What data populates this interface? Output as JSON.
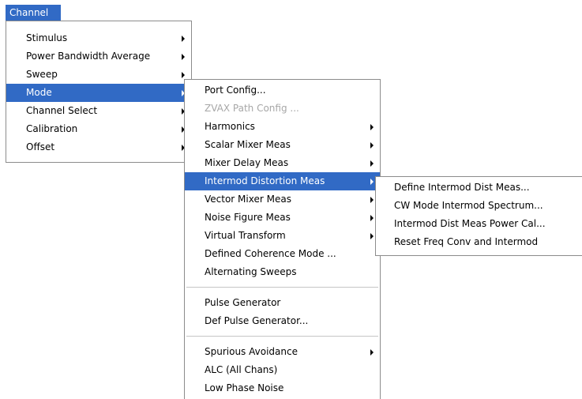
{
  "menubar": {
    "channel": "Channel"
  },
  "channel_menu": {
    "items": [
      {
        "label": "Stimulus",
        "submenu": true
      },
      {
        "label": "Power Bandwidth Average",
        "submenu": true
      },
      {
        "label": "Sweep",
        "submenu": true
      },
      {
        "label": "Mode",
        "submenu": true,
        "highlighted": true
      },
      {
        "label": "Channel Select",
        "submenu": true
      },
      {
        "label": "Calibration",
        "submenu": true
      },
      {
        "label": "Offset",
        "submenu": true
      }
    ]
  },
  "mode_menu": {
    "items": [
      {
        "label": "Port Config..."
      },
      {
        "label": "ZVAX Path Config ...",
        "disabled": true
      },
      {
        "label": "Harmonics",
        "submenu": true
      },
      {
        "label": "Scalar Mixer Meas",
        "submenu": true
      },
      {
        "label": "Mixer Delay Meas",
        "submenu": true
      },
      {
        "label": "Intermod Distortion Meas",
        "submenu": true,
        "highlighted": true
      },
      {
        "label": "Vector Mixer Meas",
        "submenu": true
      },
      {
        "label": "Noise Figure Meas",
        "submenu": true
      },
      {
        "label": "Virtual Transform",
        "submenu": true
      },
      {
        "label": "Defined Coherence Mode ..."
      },
      {
        "label": "Alternating Sweeps"
      },
      {
        "label": "Pulse Generator"
      },
      {
        "label": "Def Pulse Generator..."
      },
      {
        "label": "Spurious Avoidance",
        "submenu": true
      },
      {
        "label": "ALC (All Chans)"
      },
      {
        "label": "Low Phase Noise"
      }
    ]
  },
  "intermod_menu": {
    "items": [
      {
        "label": "Define Intermod Dist Meas..."
      },
      {
        "label": "CW Mode Intermod Spectrum..."
      },
      {
        "label": "Intermod Dist Meas Power Cal..."
      },
      {
        "label": "Reset Freq Conv and Intermod"
      }
    ]
  },
  "colors": {
    "highlight": "#316ac5",
    "disabled_text": "#a7a7a7",
    "border": "#8c8c8c"
  }
}
